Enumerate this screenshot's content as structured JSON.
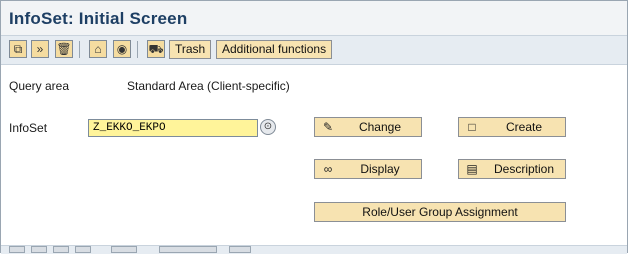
{
  "window": {
    "title": "InfoSet: Initial Screen"
  },
  "toolbar": {
    "icons": [
      "copy-icon",
      "execute-icon",
      "delete-icon",
      "hierarchy-icon",
      "lifebuoy-icon",
      "transport-icon"
    ],
    "trash_label": "Trash",
    "additional_functions_label": "Additional functions"
  },
  "query_area": {
    "label": "Query area",
    "value": "Standard Area (Client-specific)"
  },
  "infoset": {
    "label": "InfoSet",
    "value": "Z_EKKO_EKPO"
  },
  "buttons": {
    "change": "Change",
    "create": "Create",
    "display": "Display",
    "description": "Description",
    "role_assignment": "Role/User Group Assignment"
  }
}
